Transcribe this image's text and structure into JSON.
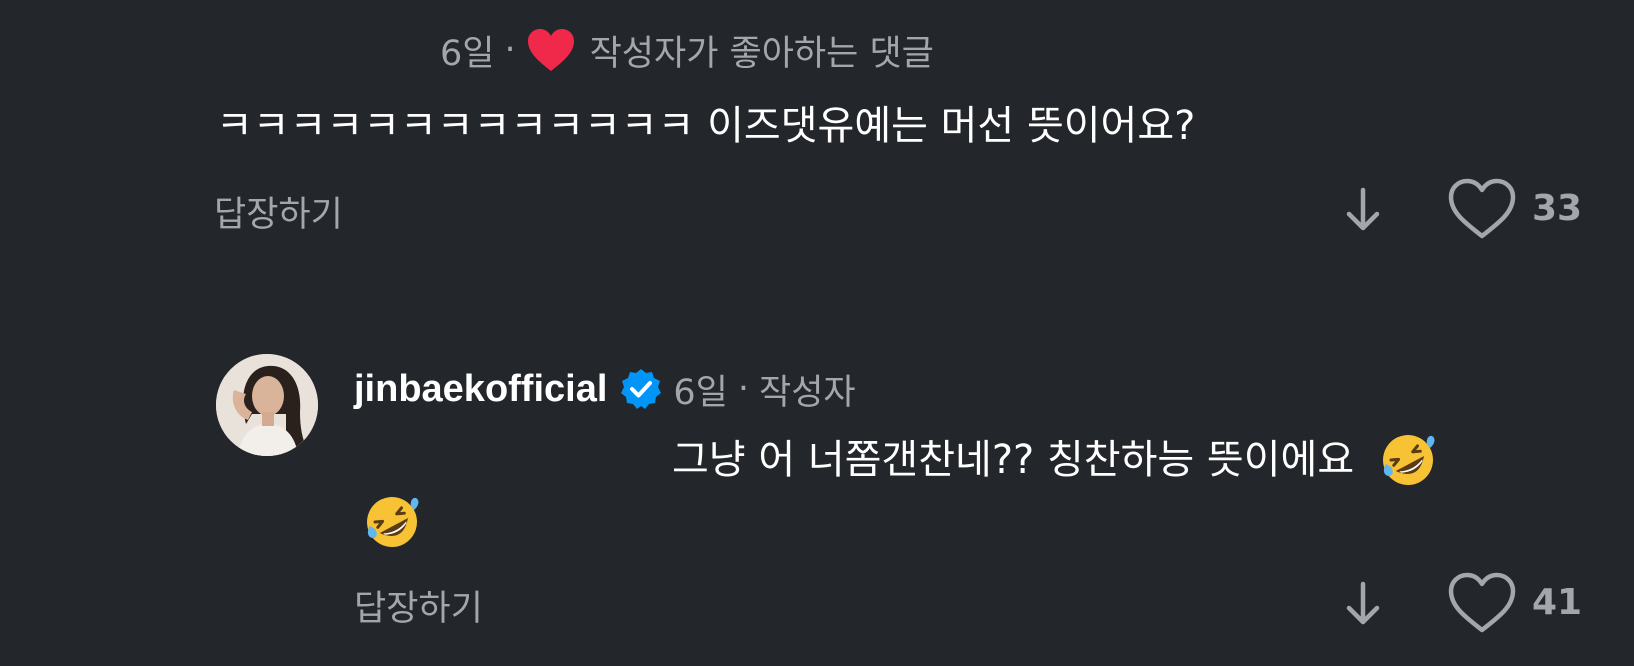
{
  "comments": [
    {
      "time": "6일",
      "separator": "·",
      "liked_by_author_label": "작성자가 좋아하는 댓글",
      "text": "ㅋㅋㅋㅋㅋㅋㅋㅋㅋㅋㅋㅋㅋ 이즈댓유예는 머선 뜻이어요?",
      "reply_label": "답장하기",
      "like_count": "33",
      "icons": [
        "red-heart-icon",
        "down-arrow-icon",
        "heart-outline-icon"
      ]
    },
    {
      "username": "jinbaekofficial",
      "verified": true,
      "time": "6일",
      "separator": "·",
      "author_label": "작성자",
      "text": "그냥 어 너쫌갠찬네?? 칭찬하능 뜻이에요",
      "emoji": "rolling-on-floor-laughing-emoji",
      "reply_label": "답장하기",
      "like_count": "41",
      "icons": [
        "verified-badge-icon",
        "down-arrow-icon",
        "heart-outline-icon"
      ]
    }
  ],
  "colors": {
    "background": "#23262b",
    "primary_text": "#ffffff",
    "secondary_text": "#a3a6ab",
    "liked_heart": "#f02849",
    "verified_badge": "#0095f6"
  }
}
